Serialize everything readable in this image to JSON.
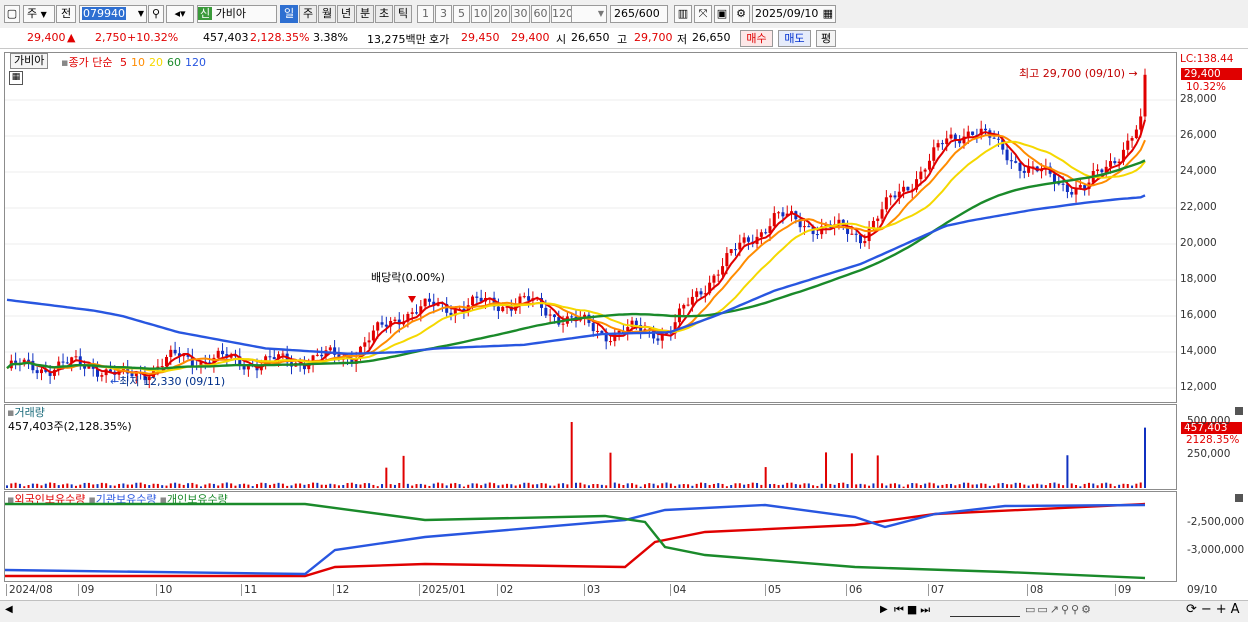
{
  "toolbar": {
    "mode": "주",
    "prev": "전",
    "code": "079940",
    "new_badge": "신",
    "stock_name": "가비아",
    "periods": [
      "일",
      "주",
      "월",
      "년",
      "분",
      "초",
      "틱"
    ],
    "numbers": [
      "1",
      "3",
      "5",
      "10",
      "20",
      "30",
      "60",
      "120"
    ],
    "count": "265",
    "count_total": "/600",
    "date": "2025/09/10"
  },
  "quote": {
    "price": "29,400",
    "change": "2,750",
    "change_pct": "+10.32%",
    "volume": "457,403",
    "volume_pct": "2,128.35%",
    "turnover_pct": "3.38%",
    "amount": "13,275백만",
    "bid_label": "호가",
    "bid1": "29,450",
    "bid2": "29,400",
    "open_label": "시",
    "open": "26,650",
    "high_label": "고",
    "high": "29,700",
    "low_label": "저",
    "low": "26,650",
    "buy": "매수",
    "sell": "매도",
    "avg": "평"
  },
  "price_panel": {
    "name": "가비아",
    "legend_prefix": "종가 단순",
    "ma_labels": [
      "5",
      "10",
      "20",
      "60",
      "120"
    ],
    "ma_colors": [
      "#e00000",
      "#ff8c00",
      "#f5d800",
      "#1a8a2a",
      "#2856e0"
    ],
    "lc": "LC:138.44",
    "last_price": "29,400",
    "last_pct": "10.32%",
    "high_note": "최고 29,700 (09/10)",
    "low_note": "최저 12,330 (09/11)",
    "dividend_note": "배당락(0.00%)",
    "yticks": [
      "28,000",
      "26,000",
      "24,000",
      "22,000",
      "20,000",
      "18,000",
      "16,000",
      "14,000",
      "12,000"
    ]
  },
  "volume_panel": {
    "title": "거래량",
    "info": "457,403주(2,128.35%)",
    "last": "457,403",
    "last_pct": "2128.35%",
    "yticks": [
      "500,000",
      "250,000"
    ]
  },
  "holding_panel": {
    "legend": [
      "외국인보유수량",
      "기관보유수량",
      "개인보유수량"
    ],
    "colors": [
      "#e00000",
      "#2856e0",
      "#1a8a2a"
    ],
    "yticks": [
      "-2,500,000",
      "-3,000,000"
    ]
  },
  "x_axis": {
    "labels": [
      "2024/08",
      "09",
      "10",
      "11",
      "12",
      "2025/01",
      "02",
      "03",
      "04",
      "05",
      "06",
      "07",
      "08",
      "09"
    ],
    "last": "09/10"
  },
  "chart_data": {
    "type": "line",
    "title": "",
    "xlabel": "",
    "ylabel": "",
    "ylim": [
      11000,
      30000
    ],
    "x": [
      "2024-08-01",
      "2024-09-01",
      "2024-09-11",
      "2024-10-01",
      "2024-11-01",
      "2024-12-01",
      "2024-12-20",
      "2025-01-01",
      "2025-02-01",
      "2025-03-01",
      "2025-03-25",
      "2025-04-10",
      "2025-05-01",
      "2025-06-01",
      "2025-07-01",
      "2025-07-10",
      "2025-08-01",
      "2025-08-20",
      "2025-09-01",
      "2025-09-09",
      "2025-09-10"
    ],
    "series": [
      {
        "name": "5",
        "values": [
          13100,
          13300,
          12500,
          13700,
          13400,
          13800,
          16200,
          16500,
          16800,
          15100,
          15200,
          18500,
          21500,
          20500,
          25600,
          26500,
          24000,
          23000,
          25200,
          26650,
          29400
        ]
      },
      {
        "name": "120",
        "values": [
          16900,
          16300,
          16000,
          15100,
          14200,
          13900,
          14000,
          14200,
          14400,
          15000,
          15100,
          16000,
          17400,
          18900,
          21000,
          21300,
          21900,
          22300,
          22500,
          22600,
          22700
        ]
      }
    ],
    "volume": {
      "unit": "주",
      "last": 457403
    },
    "markers": {
      "high": 29700,
      "high_date": "09/10",
      "low": 12330,
      "low_date": "09/11"
    }
  }
}
